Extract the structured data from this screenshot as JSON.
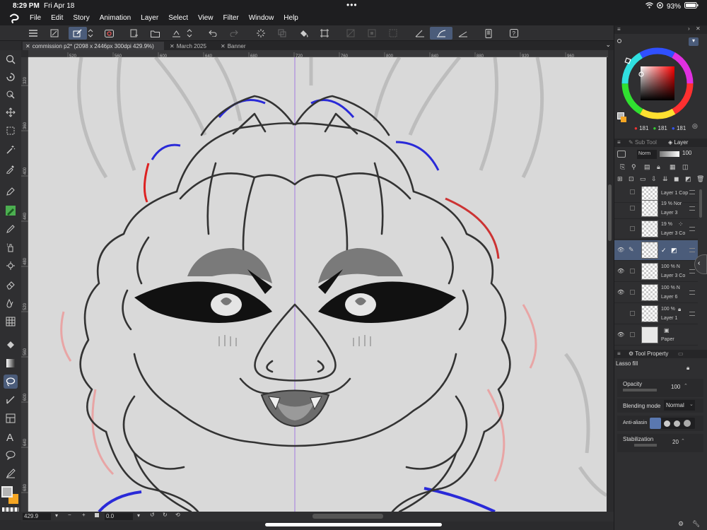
{
  "status": {
    "time": "8:29 PM",
    "date": "Fri Apr 18",
    "battery": "93%"
  },
  "menu": [
    "File",
    "Edit",
    "Story",
    "Animation",
    "Layer",
    "Select",
    "View",
    "Filter",
    "Window",
    "Help"
  ],
  "tabs": [
    {
      "label": "commission p2* (2098 x 2446px 300dpi 429.9%)",
      "active": true
    },
    {
      "label": "March 2025",
      "active": false
    },
    {
      "label": "Banner",
      "active": false
    }
  ],
  "ruler": {
    "top": [
      "520",
      "560",
      "600",
      "640",
      "680",
      "720",
      "760",
      "800",
      "840",
      "880",
      "920",
      "960"
    ],
    "left": [
      "320",
      "360",
      "400",
      "440",
      "480",
      "520",
      "560",
      "600",
      "640",
      "680"
    ]
  },
  "colors": {
    "rgb_r": "181",
    "rgb_g": "181",
    "rgb_b": "181",
    "accent": "#4b5c7a",
    "main_color": "#b5b5b5",
    "sub_color": "#f5a623"
  },
  "panels": {
    "subtool_tab": "Sub Tool",
    "layer_tab": "Layer",
    "blend_short": "Norm",
    "layer_opacity": "100",
    "tool_property_tab": "Tool Property",
    "tool_name": "Lasso fill"
  },
  "layers": [
    {
      "pct": "",
      "name": "Layer 1 Cop",
      "selected": false,
      "visible": false
    },
    {
      "pct": "19 % Nor",
      "name": "Layer 3",
      "selected": false,
      "visible": false
    },
    {
      "pct": "19 %",
      "name": "Layer 3 Co",
      "selected": false,
      "visible": false
    },
    {
      "pct": "",
      "name": "",
      "selected": true,
      "visible": true
    },
    {
      "pct": "100 % N",
      "name": "Layer 3 Co",
      "selected": false,
      "visible": true
    },
    {
      "pct": "100 % N",
      "name": "Layer 6",
      "selected": false,
      "visible": true
    },
    {
      "pct": "100 %",
      "name": "Layer 1",
      "selected": false,
      "visible": false
    },
    {
      "pct": "",
      "name": "Paper",
      "selected": false,
      "visible": true
    }
  ],
  "tool_props": {
    "opacity_label": "Opacity",
    "opacity_value": "100",
    "blend_label": "Blending mode",
    "blend_value": "Normal",
    "aa_label": "Anti-aliasin",
    "stab_label": "Stabilization",
    "stab_value": "20"
  },
  "bottom": {
    "zoom": "429.9",
    "angle": "0.0"
  }
}
